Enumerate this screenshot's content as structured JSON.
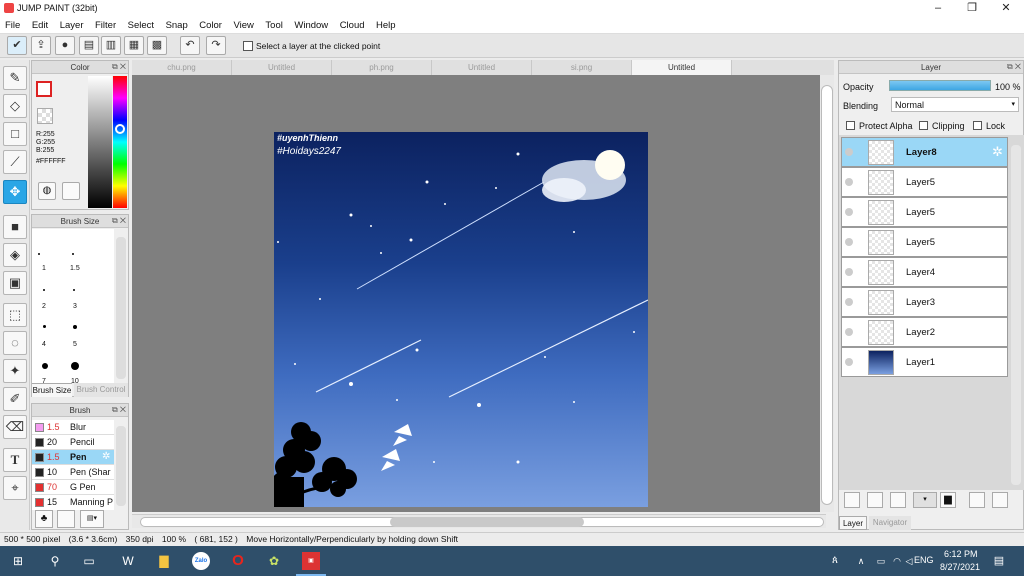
{
  "window": {
    "title": "JUMP PAINT (32bit)",
    "minimize": "–",
    "maximize": "❐",
    "close": "✕"
  },
  "menu": [
    "File",
    "Edit",
    "Layer",
    "Filter",
    "Select",
    "Snap",
    "Color",
    "View",
    "Tool",
    "Window",
    "Cloud",
    "Help"
  ],
  "toolbar": {
    "select_layer_label": "Select a layer at the clicked point"
  },
  "color_panel": {
    "title": "Color",
    "r": "R:255",
    "g": "G:255",
    "b": "B:255",
    "hex": "#FFFFFF"
  },
  "brushsize_panel": {
    "title": "Brush Size",
    "sizes": [
      "1",
      "1.5",
      "2",
      "3",
      "4",
      "5",
      "7",
      "10"
    ],
    "tab_active": "Brush Size",
    "tab_inactive": "Brush Control"
  },
  "brush_panel": {
    "title": "Brush",
    "items": [
      {
        "size": "1.5",
        "name": "Blur",
        "color": "#f49cf0"
      },
      {
        "size": "20",
        "name": "Pencil",
        "color": "#222222"
      },
      {
        "size": "1.5",
        "name": "Pen",
        "color": "#222222"
      },
      {
        "size": "10",
        "name": "Pen (Shar",
        "color": "#222222"
      },
      {
        "size": "70",
        "name": "G Pen",
        "color": "#e33030"
      },
      {
        "size": "15",
        "name": "Manning P",
        "color": "#e33030"
      }
    ]
  },
  "tabs": [
    "chu.png",
    "Untitled",
    "ph.png",
    "Untitled",
    "si.png",
    "Untitled"
  ],
  "artwork": {
    "line1": "#uyenhThienn",
    "line2": "#Hoidays2247"
  },
  "layer_panel": {
    "title": "Layer",
    "opacity_label": "Opacity",
    "opacity_value": "100 %",
    "blending_label": "Blending",
    "blending_value": "Normal",
    "protect_alpha": "Protect Alpha",
    "clipping": "Clipping",
    "lock": "Lock",
    "layers": [
      "Layer8",
      "Layer5",
      "Layer5",
      "Layer5",
      "Layer4",
      "Layer3",
      "Layer2",
      "Layer1"
    ],
    "tab_active": "Layer",
    "tab_inactive": "Navigator"
  },
  "status": {
    "dims": "500 * 500 pixel",
    "size": "(3.6 * 3.6cm)",
    "dpi": "350 dpi",
    "zoom": "100 %",
    "coords": "( 681, 152 )",
    "hint": "Move Horizontally/Perpendicularly by holding down Shift"
  },
  "taskbar": {
    "lang": "ENG",
    "time": "6:12 PM",
    "date": "8/27/2021"
  },
  "colors": {
    "accent": "#2aa6e6",
    "selected_layer": "#9ad7f6",
    "taskbar": "#2f4f6a"
  }
}
